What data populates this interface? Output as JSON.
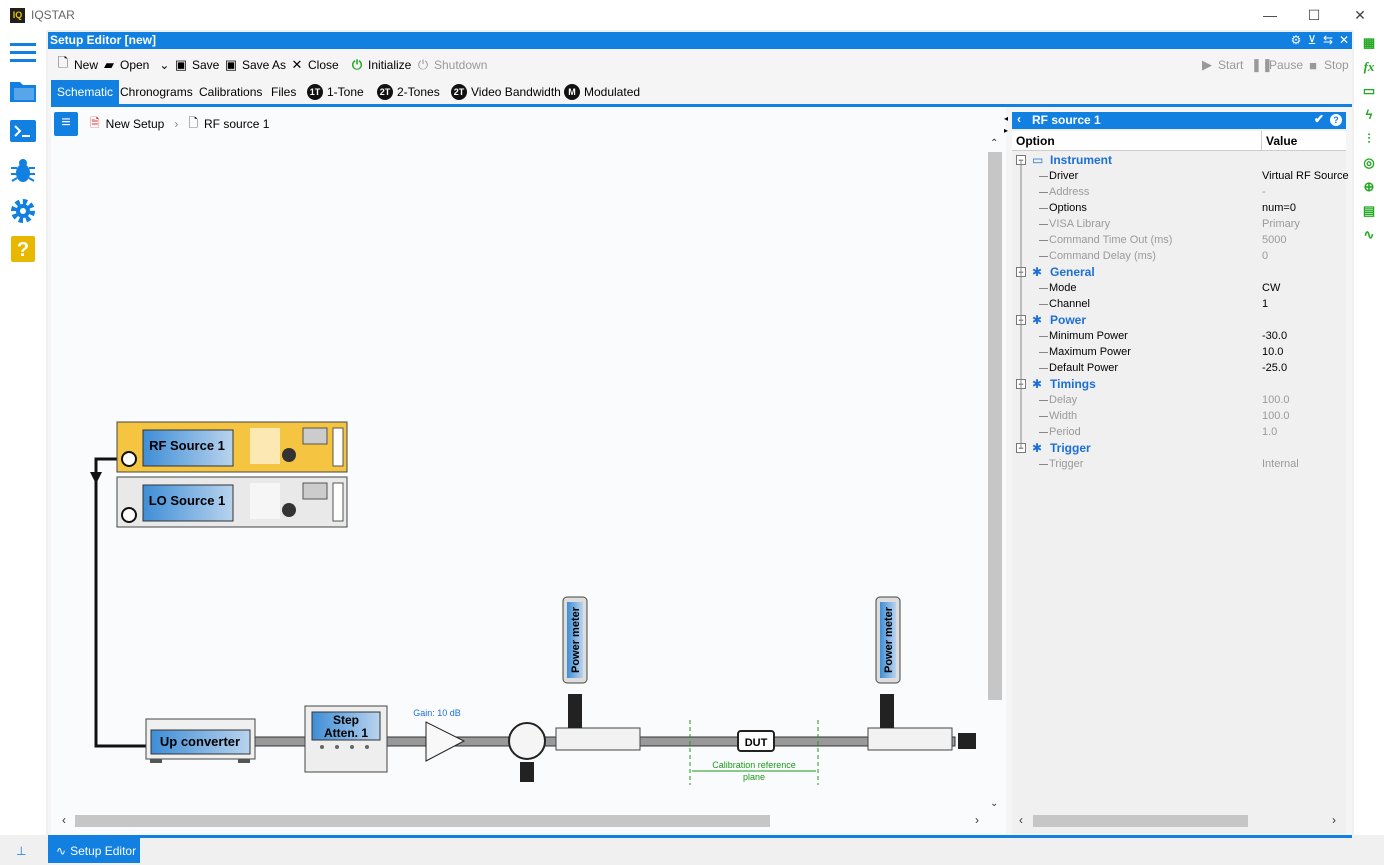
{
  "app": {
    "title": "IQSTAR",
    "logo": "IQ"
  },
  "window_controls": {
    "minimize": "—",
    "maximize": "☐",
    "close": "✕"
  },
  "editor": {
    "title": "Setup Editor [new]",
    "toolbar": {
      "new": "New",
      "open": "Open",
      "save": "Save",
      "save_as": "Save As",
      "close": "Close",
      "initialize": "Initialize",
      "shutdown": "Shutdown",
      "start": "Start",
      "pause": "Pause",
      "stop": "Stop"
    },
    "tabs": [
      {
        "label": "Schematic"
      },
      {
        "label": "Chronograms"
      },
      {
        "label": "Calibrations"
      },
      {
        "label": "Files"
      },
      {
        "label": "1-Tone",
        "badge": "1T"
      },
      {
        "label": "2-Tones",
        "badge": "2T"
      },
      {
        "label": "Video Bandwidth",
        "badge": "2T"
      },
      {
        "label": "Modulated",
        "badge": "M"
      }
    ],
    "breadcrumb": {
      "root": "New Setup",
      "current": "RF source 1"
    }
  },
  "schematic": {
    "rf_source": "RF Source 1",
    "lo_source": "LO Source 1",
    "up_converter": "Up converter",
    "step_atten_line1": "Step",
    "step_atten_line2": "Atten. 1",
    "gain_label": "Gain: 10 dB",
    "power_meter": "Power meter",
    "dut": "DUT",
    "calibration_line1": "Calibration reference",
    "calibration_line2": "plane"
  },
  "properties": {
    "title": "RF source 1",
    "col_option": "Option",
    "col_value": "Value",
    "rows": [
      {
        "type": "cat",
        "name": "Instrument"
      },
      {
        "type": "prop",
        "name": "Driver",
        "value": "Virtual RF Source",
        "dim": false
      },
      {
        "type": "prop",
        "name": "Address",
        "value": "-",
        "dim": true
      },
      {
        "type": "prop",
        "name": "Options",
        "value": "num=0",
        "dim": false
      },
      {
        "type": "prop",
        "name": "VISA Library",
        "value": "Primary",
        "dim": true
      },
      {
        "type": "prop",
        "name": "Command Time Out (ms)",
        "value": "5000",
        "dim": true
      },
      {
        "type": "prop",
        "name": "Command Delay (ms)",
        "value": "0",
        "dim": true
      },
      {
        "type": "cat",
        "name": "General"
      },
      {
        "type": "prop",
        "name": "Mode",
        "value": "CW",
        "dim": false
      },
      {
        "type": "prop",
        "name": "Channel",
        "value": "1",
        "dim": false
      },
      {
        "type": "cat",
        "name": "Power"
      },
      {
        "type": "prop",
        "name": "Minimum Power",
        "value": "-30.0",
        "dim": false
      },
      {
        "type": "prop",
        "name": "Maximum Power",
        "value": "10.0",
        "dim": false
      },
      {
        "type": "prop",
        "name": "Default Power",
        "value": "-25.0",
        "dim": false
      },
      {
        "type": "cat",
        "name": "Timings"
      },
      {
        "type": "prop",
        "name": "Delay",
        "value": "100.0",
        "dim": true
      },
      {
        "type": "prop",
        "name": "Width",
        "value": "100.0",
        "dim": true
      },
      {
        "type": "prop",
        "name": "Period",
        "value": "1.0",
        "dim": true
      },
      {
        "type": "cat",
        "name": "Trigger"
      },
      {
        "type": "prop",
        "name": "Trigger",
        "value": "Internal",
        "dim": true
      }
    ]
  },
  "bottom_tab": {
    "label": "Setup Editor"
  },
  "colors": {
    "accent": "#1180e0",
    "green": "#22a822",
    "rf_yellow": "#f5c542"
  }
}
